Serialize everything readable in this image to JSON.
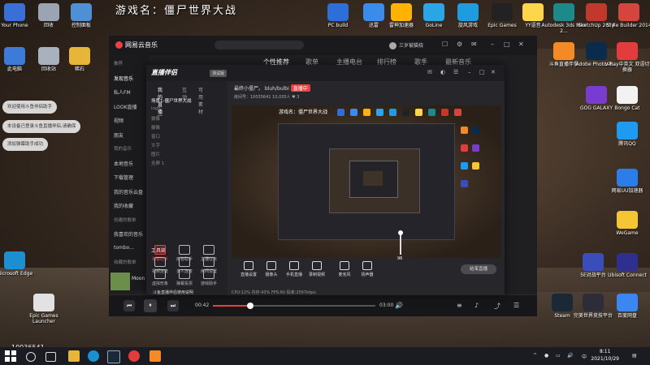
{
  "game_title": "游戏名：僵尸世界大战",
  "desktop_icons_top": [
    {
      "label": "Your Phone",
      "color": "#3b6fd8"
    },
    {
      "label": "回收",
      "color": "#9aa4b2"
    },
    {
      "label": "控制面板",
      "color": "#4f8fd6"
    },
    {
      "label": "PC build",
      "color": "#2d6ed8"
    },
    {
      "label": "迅雷",
      "color": "#3b8bea"
    },
    {
      "label": "雷神加速器",
      "color": "#ffb300"
    },
    {
      "label": "GoLine",
      "color": "#2aa6e6"
    },
    {
      "label": "旋风游戏",
      "color": "#1f9be0"
    },
    {
      "label": "Epic Games",
      "color": "#222222"
    },
    {
      "label": "YY语音",
      "color": "#ffd54a"
    },
    {
      "label": "Autodesk 3ds Max 2...",
      "color": "#1d8a8a"
    },
    {
      "label": "SketchUp 2014",
      "color": "#c0392b"
    },
    {
      "label": "Style Builder 2014",
      "color": "#d6453d"
    }
  ],
  "desktop_icons_left": [
    {
      "label": "此电脑",
      "color": "#3d7bd8"
    },
    {
      "label": "回收站",
      "color": "#a8b2bf"
    },
    {
      "label": "稀石",
      "color": "#e7b53a"
    }
  ],
  "desktop_icons_right": [
    {
      "label": "斗鱼直播伴侣",
      "color": "#f48a25"
    },
    {
      "label": "Adobe Photosh...",
      "color": "#0b2b4d"
    },
    {
      "label": "V-Ray中英文 双语切换器",
      "color": "#e23c3c"
    },
    {
      "label": "GOG GALAXY",
      "color": "#7a3ccf"
    },
    {
      "label": "Bongo Cat",
      "color": "#f2f2f2"
    },
    {
      "label": "腾讯QQ",
      "color": "#1e9bf0"
    },
    {
      "label": "网易UU加速器",
      "color": "#2b7de9"
    },
    {
      "label": "WeGame",
      "color": "#f5c533"
    },
    {
      "label": "5E对战平台",
      "color": "#3a4dbb"
    },
    {
      "label": "Ubisoft Connect",
      "color": "#2f2f8f"
    },
    {
      "label": "Steam",
      "color": "#1b2838"
    },
    {
      "label": "完美世界竞技平台",
      "color": "#2d2d3a"
    },
    {
      "label": "百度网盘",
      "color": "#3b87f1"
    }
  ],
  "desktop_icons_bottom_left": [
    {
      "label": "Microsoft Edge",
      "color": "#1b8fcf"
    },
    {
      "label": "Epic Games Launcher",
      "color": "#e2e2e2"
    }
  ],
  "notifications": [
    "欢迎使用斗鱼伴侣助手",
    "本设备已登录斗鱼直播伴侣,请确保",
    "添加弹幕助手成功"
  ],
  "netease": {
    "logo": "网易云音乐",
    "user": "三岁被猫挠",
    "tabs": [
      "个性推荐",
      "歌单",
      "主播电台",
      "排行榜",
      "歌手",
      "最新音乐"
    ],
    "sidebar": [
      {
        "label": "推荐",
        "type": "head"
      },
      {
        "label": "发现音乐",
        "type": "sel"
      },
      {
        "label": "私人FM",
        "type": "item"
      },
      {
        "label": "LOOK直播",
        "type": "item"
      },
      {
        "label": "视频",
        "type": "item"
      },
      {
        "label": "朋友",
        "type": "item"
      },
      {
        "label": "我的音乐",
        "type": "head"
      },
      {
        "label": "本地音乐",
        "type": "item"
      },
      {
        "label": "下载管理",
        "type": "item"
      },
      {
        "label": "我的音乐云盘",
        "type": "item"
      },
      {
        "label": "我的收藏",
        "type": "item"
      },
      {
        "label": "创建的歌单",
        "type": "head"
      },
      {
        "label": "我喜欢的音乐",
        "type": "item"
      },
      {
        "label": "tombo...",
        "type": "item"
      },
      {
        "label": "收藏的歌单",
        "type": "head"
      }
    ],
    "now_playing": "Moon",
    "time_current": "00:42",
    "time_total": "03:00",
    "progress": 0.23
  },
  "live": {
    "logo": "直播伴侣",
    "badge": "测试版",
    "left_tabs": [
      "我的直播",
      "互动",
      "可用素材"
    ],
    "scenes": [
      "场景1-僵尸世界大战",
      "logo",
      "摄像",
      "摄像",
      "窗口",
      "文字",
      "图片",
      "全屏 1"
    ],
    "tools_label": "工具箱",
    "tools": [
      {
        "label": "弹幕助手",
        "red": true
      },
      {
        "label": "房管助手",
        "red": false
      },
      {
        "label": "主播任务",
        "red": false
      },
      {
        "label": "视频连麦",
        "red": false
      },
      {
        "label": "多人连麦",
        "red": false
      },
      {
        "label": "房间设置",
        "red": false
      },
      {
        "label": "虚拟形象",
        "red": false
      },
      {
        "label": "弹幕投票",
        "red": false
      },
      {
        "label": "游戏助手",
        "red": false
      }
    ],
    "notice": "斗鱼直播伴侣使用说明",
    "stream_info": "最终小僵尸。 bluh/bulbi",
    "live_tag": "直播中",
    "sub_info": "房间号：10035641  10,035人  ♥ 3",
    "preview_title": "游戏名：僵尸世界大战",
    "bottom_tools": [
      "直播设置",
      "摄像头",
      "手机直播",
      "录制视频",
      "麦克风",
      "扬声器"
    ],
    "go_live": "结束直播",
    "status": "CPU:12%  内存:43%  FPS:60  码率:2567kbps",
    "volume_value": "96"
  },
  "taskbar": {
    "time": "8:11",
    "date": "2021/10/29",
    "lang": "中"
  },
  "counter": "10036541"
}
